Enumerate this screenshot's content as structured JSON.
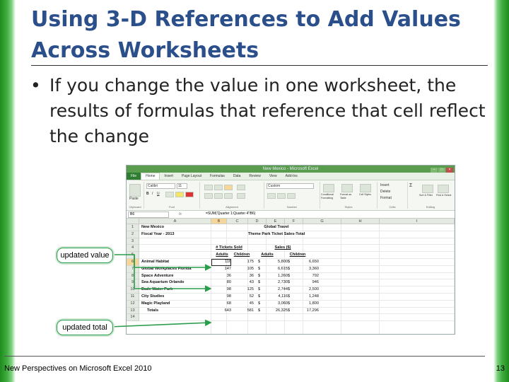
{
  "slide": {
    "title_line1": "Using 3-D References to Add Values",
    "title_line2": "Across Worksheets",
    "bullet_symbol": "•",
    "bullet_text": "If you change the value in one worksheet, the results of formulas that reference that cell reflect the change",
    "footer": "New Perspectives on Microsoft Excel 2010",
    "page_number": "13"
  },
  "callouts": {
    "updated_value": "updated value",
    "updated_total": "updated total"
  },
  "excel": {
    "window_title": "New Mexico - Microsoft Excel",
    "tabs": [
      "File",
      "Home",
      "Insert",
      "Page Layout",
      "Formulas",
      "Data",
      "Review",
      "View",
      "Add-Ins"
    ],
    "ribbon": {
      "font_name": "Calibri",
      "font_size": "11",
      "number_format": "Custom",
      "groups": [
        "Clipboard",
        "Font",
        "Alignment",
        "Number",
        "Styles",
        "Cells",
        "Editing"
      ],
      "paste": "Paste",
      "insert": "Insert",
      "delete": "Delete",
      "format": "Format",
      "conditional_formatting": "Conditional Formatting",
      "format_as_table": "Format as Table",
      "cell_styles": "Cell Styles",
      "sort_filter": "Sort & Filter",
      "find_select": "Find & Select"
    },
    "name_box": "B6",
    "fx": "fx",
    "formula": "=SUM('Quarter 1:Quarter 4'!B6)",
    "columns": [
      "A",
      "B",
      "C",
      "D",
      "E",
      "F",
      "G",
      "H",
      "I"
    ],
    "rows": [
      {
        "num": "1",
        "a": "New Mexico",
        "title": "Global Travel"
      },
      {
        "num": "2",
        "a": "Fiscal Year - 2013",
        "title": "Theme Park Ticket Sales-Total"
      },
      {
        "num": "3"
      },
      {
        "num": "4",
        "h1": "# Tickets Sold",
        "h2": "Sales ($)"
      },
      {
        "num": "5",
        "b": "Adults",
        "c": "Children",
        "d": "Adults",
        "e": "Children"
      },
      {
        "num": "6",
        "a": "Animal Habitat",
        "b": "116",
        "c": "175",
        "d1": "$",
        "d": "5,800",
        "e1": "$",
        "e": "6,650"
      },
      {
        "num": "7",
        "a": "Global Workplaces Florida",
        "b": "147",
        "c": "105",
        "d1": "$",
        "d": "6,615",
        "e1": "$",
        "e": "3,360"
      },
      {
        "num": "8",
        "a": "Space Adventure",
        "b": "36",
        "c": "36",
        "d1": "$",
        "d": "1,260",
        "e1": "$",
        "e": "792"
      },
      {
        "num": "9",
        "a": "Sea Aquarium Orlando",
        "b": "80",
        "c": "43",
        "d1": "$",
        "d": "2,730",
        "e1": "$",
        "e": "946"
      },
      {
        "num": "10",
        "a": "Dade Water Park",
        "b": "98",
        "c": "125",
        "d1": "$",
        "d": "2,744",
        "e1": "$",
        "e": "2,500"
      },
      {
        "num": "11",
        "a": "City Studies",
        "b": "98",
        "c": "52",
        "d1": "$",
        "d": "4,116",
        "e1": "$",
        "e": "1,248"
      },
      {
        "num": "12",
        "a": "Magic Playland",
        "b": "68",
        "c": "45",
        "d1": "$",
        "d": "3,060",
        "e1": "$",
        "e": "1,800"
      },
      {
        "num": "13",
        "a": "Totals",
        "b": "643",
        "c": "581",
        "d1": "$",
        "d": "26,325",
        "e1": "$",
        "e": "17,296"
      },
      {
        "num": "14"
      }
    ]
  },
  "colors": {
    "title": "#2b4f8a",
    "accent_green": "#2a9d4a",
    "side_bar": "#3fae3f"
  }
}
